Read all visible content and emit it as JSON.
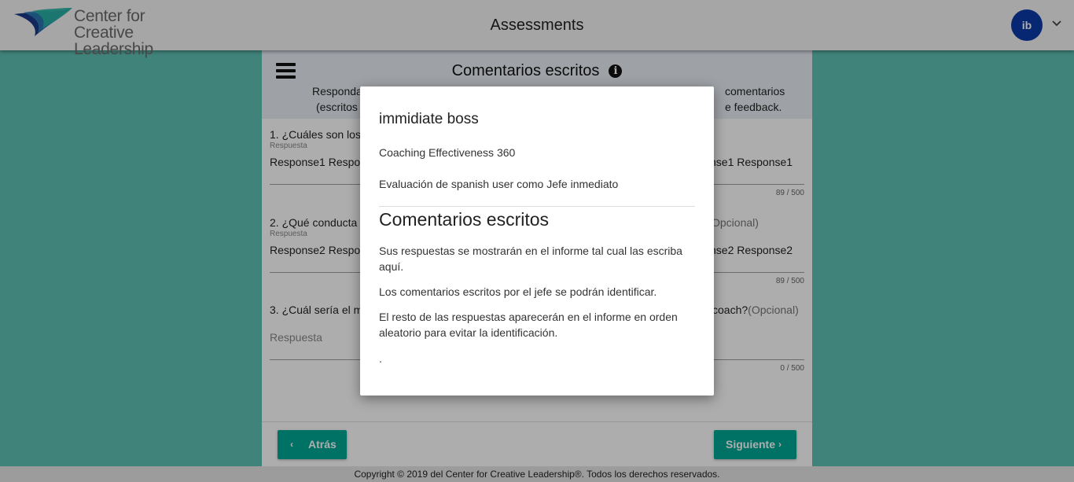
{
  "header": {
    "logo_line1": "Center for",
    "logo_line2": "Creative Leadership",
    "title": "Assessments",
    "avatar_initials": "ib"
  },
  "section": {
    "title": "Comentarios escritos",
    "intro_left_1": "Responda",
    "intro_left_2": "(escritos",
    "intro_right_1": "comentarios",
    "intro_right_2": "e feedback."
  },
  "questions": [
    {
      "text_left": "1. ¿Cuáles son los",
      "text_right": "",
      "label": "Respuesta",
      "answer_left": [
        "Response1",
        "Respo"
      ],
      "answer_right": [
        "nse1",
        "Response1"
      ],
      "counter": "89 / 500"
    },
    {
      "text_left": "2. ¿Qué conducta",
      "text_right": "Opcional)",
      "label": "Respuesta",
      "answer_left": [
        "Response2",
        "Respo"
      ],
      "answer_right": [
        "nse2",
        "Response2"
      ],
      "counter": "89 / 500"
    },
    {
      "text_left": "3. ¿Cuál sería el m",
      "text_right_main": "coach?",
      "text_right_opt": "(Opcional)",
      "placeholder": "Respuesta",
      "counter": "0 / 500"
    }
  ],
  "nav": {
    "back_label": "Atrás",
    "next_label": "Siguiente"
  },
  "footer": {
    "copyright": "Copyright © 2019 del Center for Creative Leadership®. Todos los derechos reservados."
  },
  "modal": {
    "rater": "immidiate boss",
    "assessment": "Coaching Effectiveness 360",
    "evaluation": "Evaluación de spanish user como Jefe inmediato",
    "heading": "Comentarios escritos",
    "para1": "Sus respuestas se mostrarán en el informe tal cual las escriba aquí.",
    "para2": "Los comentarios escritos por el jefe se podrán identificar.",
    "para3": "El resto de las respuestas aparecerán en el informe en orden aleatorio para evitar la identificación.",
    "para4": "."
  },
  "colors": {
    "page_background": "#5fc1b5",
    "accent_button": "#00a896",
    "avatar": "#0b3aa8",
    "section_header": "#e9eef5"
  },
  "icons": [
    "ccl-logo-icon",
    "chevron-down-icon",
    "menu-icon",
    "info-icon",
    "chevron-left-icon",
    "chevron-right-icon"
  ]
}
